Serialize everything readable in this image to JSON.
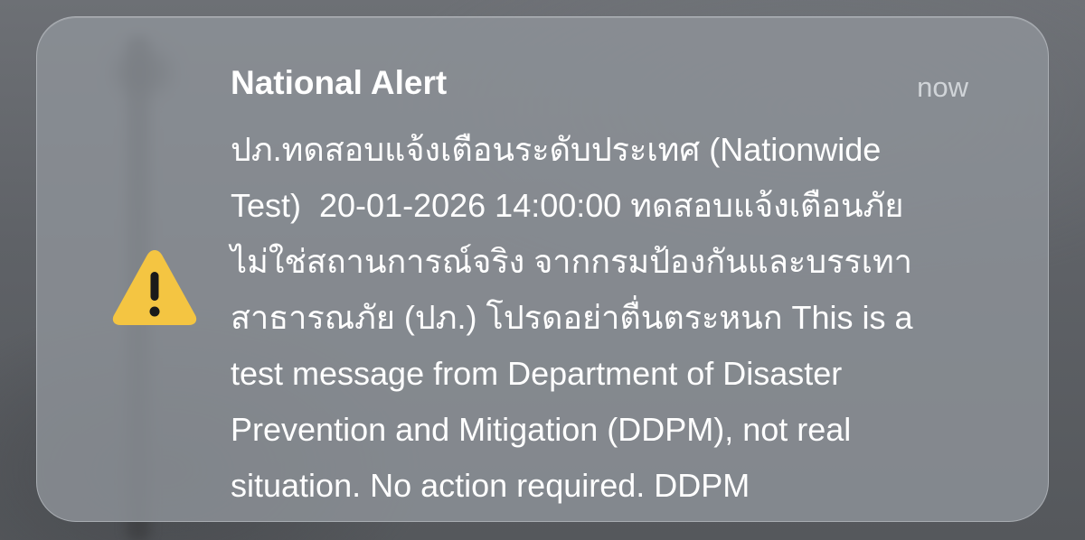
{
  "notification": {
    "title": "National Alert",
    "time": "now",
    "icon": "warning-icon",
    "accent_color": "#f4c542",
    "message_lines": [
      "ปภ.ทดสอบแจ้งเตือนระดับประเทศ (Nationwide",
      "Test)  20-01-2026 14:00:00 ทดสอบแจ้งเตือนภัย",
      "ไม่ใช่สถานการณ์จริง จากกรมป้องกันและบรรเทา",
      "สาธารณภัย (ปภ.) โปรดอย่าตื่นตระหนก This is a",
      "test message from Department of Disaster",
      "Prevention and Mitigation (DDPM), not real",
      "situation. No action required. DDPM"
    ]
  }
}
